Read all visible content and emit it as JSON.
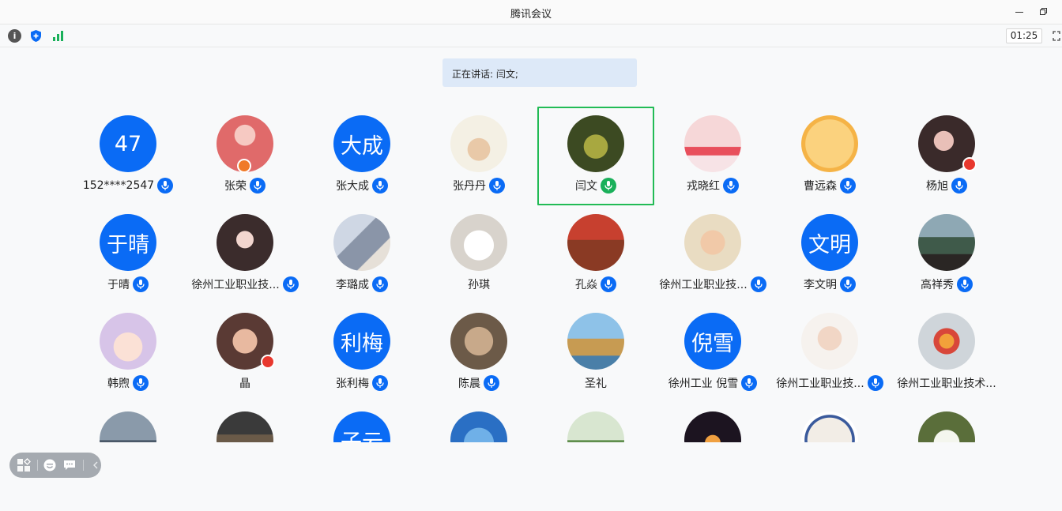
{
  "window": {
    "title": "腾讯会议"
  },
  "toolbar": {
    "timer": "01:25"
  },
  "banner": {
    "speaking": "正在讲话: 闫文;"
  },
  "participants": [
    {
      "name": "152****2547",
      "avatar_text": "47",
      "mic": "muted"
    },
    {
      "name": "张荣",
      "avatar_icon": "woman-bunny-ears-photo",
      "mic": "muted",
      "badge": "host-icon"
    },
    {
      "name": "张大成",
      "avatar_text": "大成",
      "mic": "muted"
    },
    {
      "name": "张丹丹",
      "avatar_icon": "pig-drawing-photo",
      "mic": "muted"
    },
    {
      "name": "闫文",
      "avatar_icon": "green-dress-photo",
      "mic": "speaking",
      "active": true
    },
    {
      "name": "戎晓红",
      "avatar_icon": "pink-scene-photo",
      "mic": "muted"
    },
    {
      "name": "曹远森",
      "avatar_icon": "calligraphy-photo",
      "mic": "muted"
    },
    {
      "name": "杨旭",
      "avatar_icon": "anime-girl-photo",
      "mic": "muted",
      "badge": "flag-icon"
    },
    {
      "name": "于晴",
      "avatar_text": "于晴",
      "mic": "muted"
    },
    {
      "name": "徐州工业职业技...",
      "avatar_icon": "drawn-girl-photo",
      "mic": "muted"
    },
    {
      "name": "李璐成",
      "avatar_icon": "two-women-photo",
      "mic": "muted"
    },
    {
      "name": "孙琪",
      "avatar_icon": "white-cat-photo",
      "mic": "none"
    },
    {
      "name": "孔焱",
      "avatar_icon": "red-forest-photo",
      "mic": "muted"
    },
    {
      "name": "徐州工业职业技...",
      "avatar_icon": "cartoon-girl-photo",
      "mic": "muted"
    },
    {
      "name": "李文明",
      "avatar_text": "文明",
      "mic": "muted"
    },
    {
      "name": "高祥秀",
      "avatar_icon": "lake-view-photo",
      "mic": "muted"
    },
    {
      "name": "韩煦",
      "avatar_icon": "cartoon-crying-girl-photo",
      "mic": "muted"
    },
    {
      "name": "晶",
      "avatar_icon": "woman-glasses-photo",
      "mic": "none",
      "badge": "flag-icon"
    },
    {
      "name": "张利梅",
      "avatar_text": "利梅",
      "mic": "muted"
    },
    {
      "name": "陈晨",
      "avatar_icon": "cartoon-couple-photo",
      "mic": "muted"
    },
    {
      "name": "圣礼",
      "avatar_icon": "sailing-ship-photo",
      "mic": "none"
    },
    {
      "name": "徐州工业  倪雪",
      "avatar_text": "倪雪",
      "mic": "muted"
    },
    {
      "name": "徐州工业职业技...",
      "avatar_icon": "woman-portrait-photo",
      "mic": "muted"
    },
    {
      "name": "徐州工业职业技术...",
      "avatar_icon": "fruit-plate-photo",
      "mic": "none"
    },
    {
      "name": "",
      "avatar_icon": "statue-photo",
      "mic": "none"
    },
    {
      "name": "",
      "avatar_icon": "city-skyline-photo",
      "mic": "none"
    },
    {
      "name": "",
      "avatar_text": "子云",
      "mic": "none"
    },
    {
      "name": "",
      "avatar_icon": "squirtle-photo",
      "mic": "none"
    },
    {
      "name": "",
      "avatar_icon": "woman-garden-photo",
      "mic": "none"
    },
    {
      "name": "",
      "avatar_icon": "night-lights-photo",
      "mic": "none"
    },
    {
      "name": "",
      "avatar_icon": "school-seal-photo",
      "mic": "none"
    },
    {
      "name": "",
      "avatar_icon": "white-flower-photo",
      "mic": "none"
    }
  ],
  "colors": {
    "accent": "#0a6bf5",
    "speaking": "#1ab05a",
    "active_border": "#22bb55",
    "banner": "#dde9f8"
  }
}
